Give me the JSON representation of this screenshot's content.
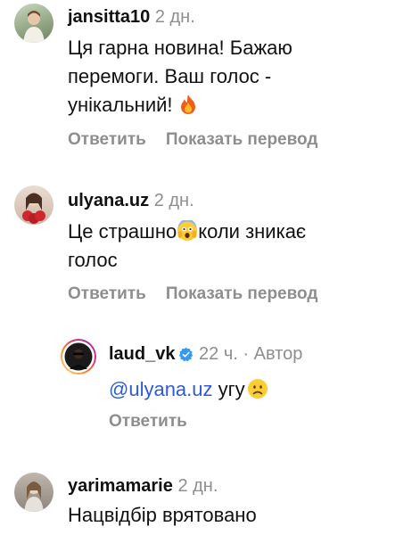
{
  "comments": [
    {
      "username": "jansitta10",
      "time": "2 дн.",
      "text_lines": [
        "Ця гарна новина! Бажаю",
        "перемоги. Ваш голос -",
        "унікальний!"
      ],
      "emoji": "fire-emoji",
      "reply_label": "Ответить",
      "translate_label": "Показать перевод"
    },
    {
      "username": "ulyana.uz",
      "time": "2 дн.",
      "text_part1": "Це страшно",
      "text_part2": "коли зникає",
      "text_line2": "голос",
      "emoji": "scared-face-emoji",
      "reply_label": "Ответить",
      "translate_label": "Показать перевод"
    },
    {
      "username": "laud_vk",
      "verified": true,
      "time": "22 ч.",
      "separator": "·",
      "author_label": "Автор",
      "mention": "@ulyana.uz",
      "text": "угу",
      "emoji": "frowning-face-emoji",
      "reply_label": "Ответить"
    },
    {
      "username": "yarimamarie",
      "time": "2 дн.",
      "text": "Нацвідбір врятовано"
    }
  ],
  "colors": {
    "secondary_text": "#8e8e8e",
    "mention": "#2e5bd6",
    "verified_badge": "#3897f0"
  }
}
